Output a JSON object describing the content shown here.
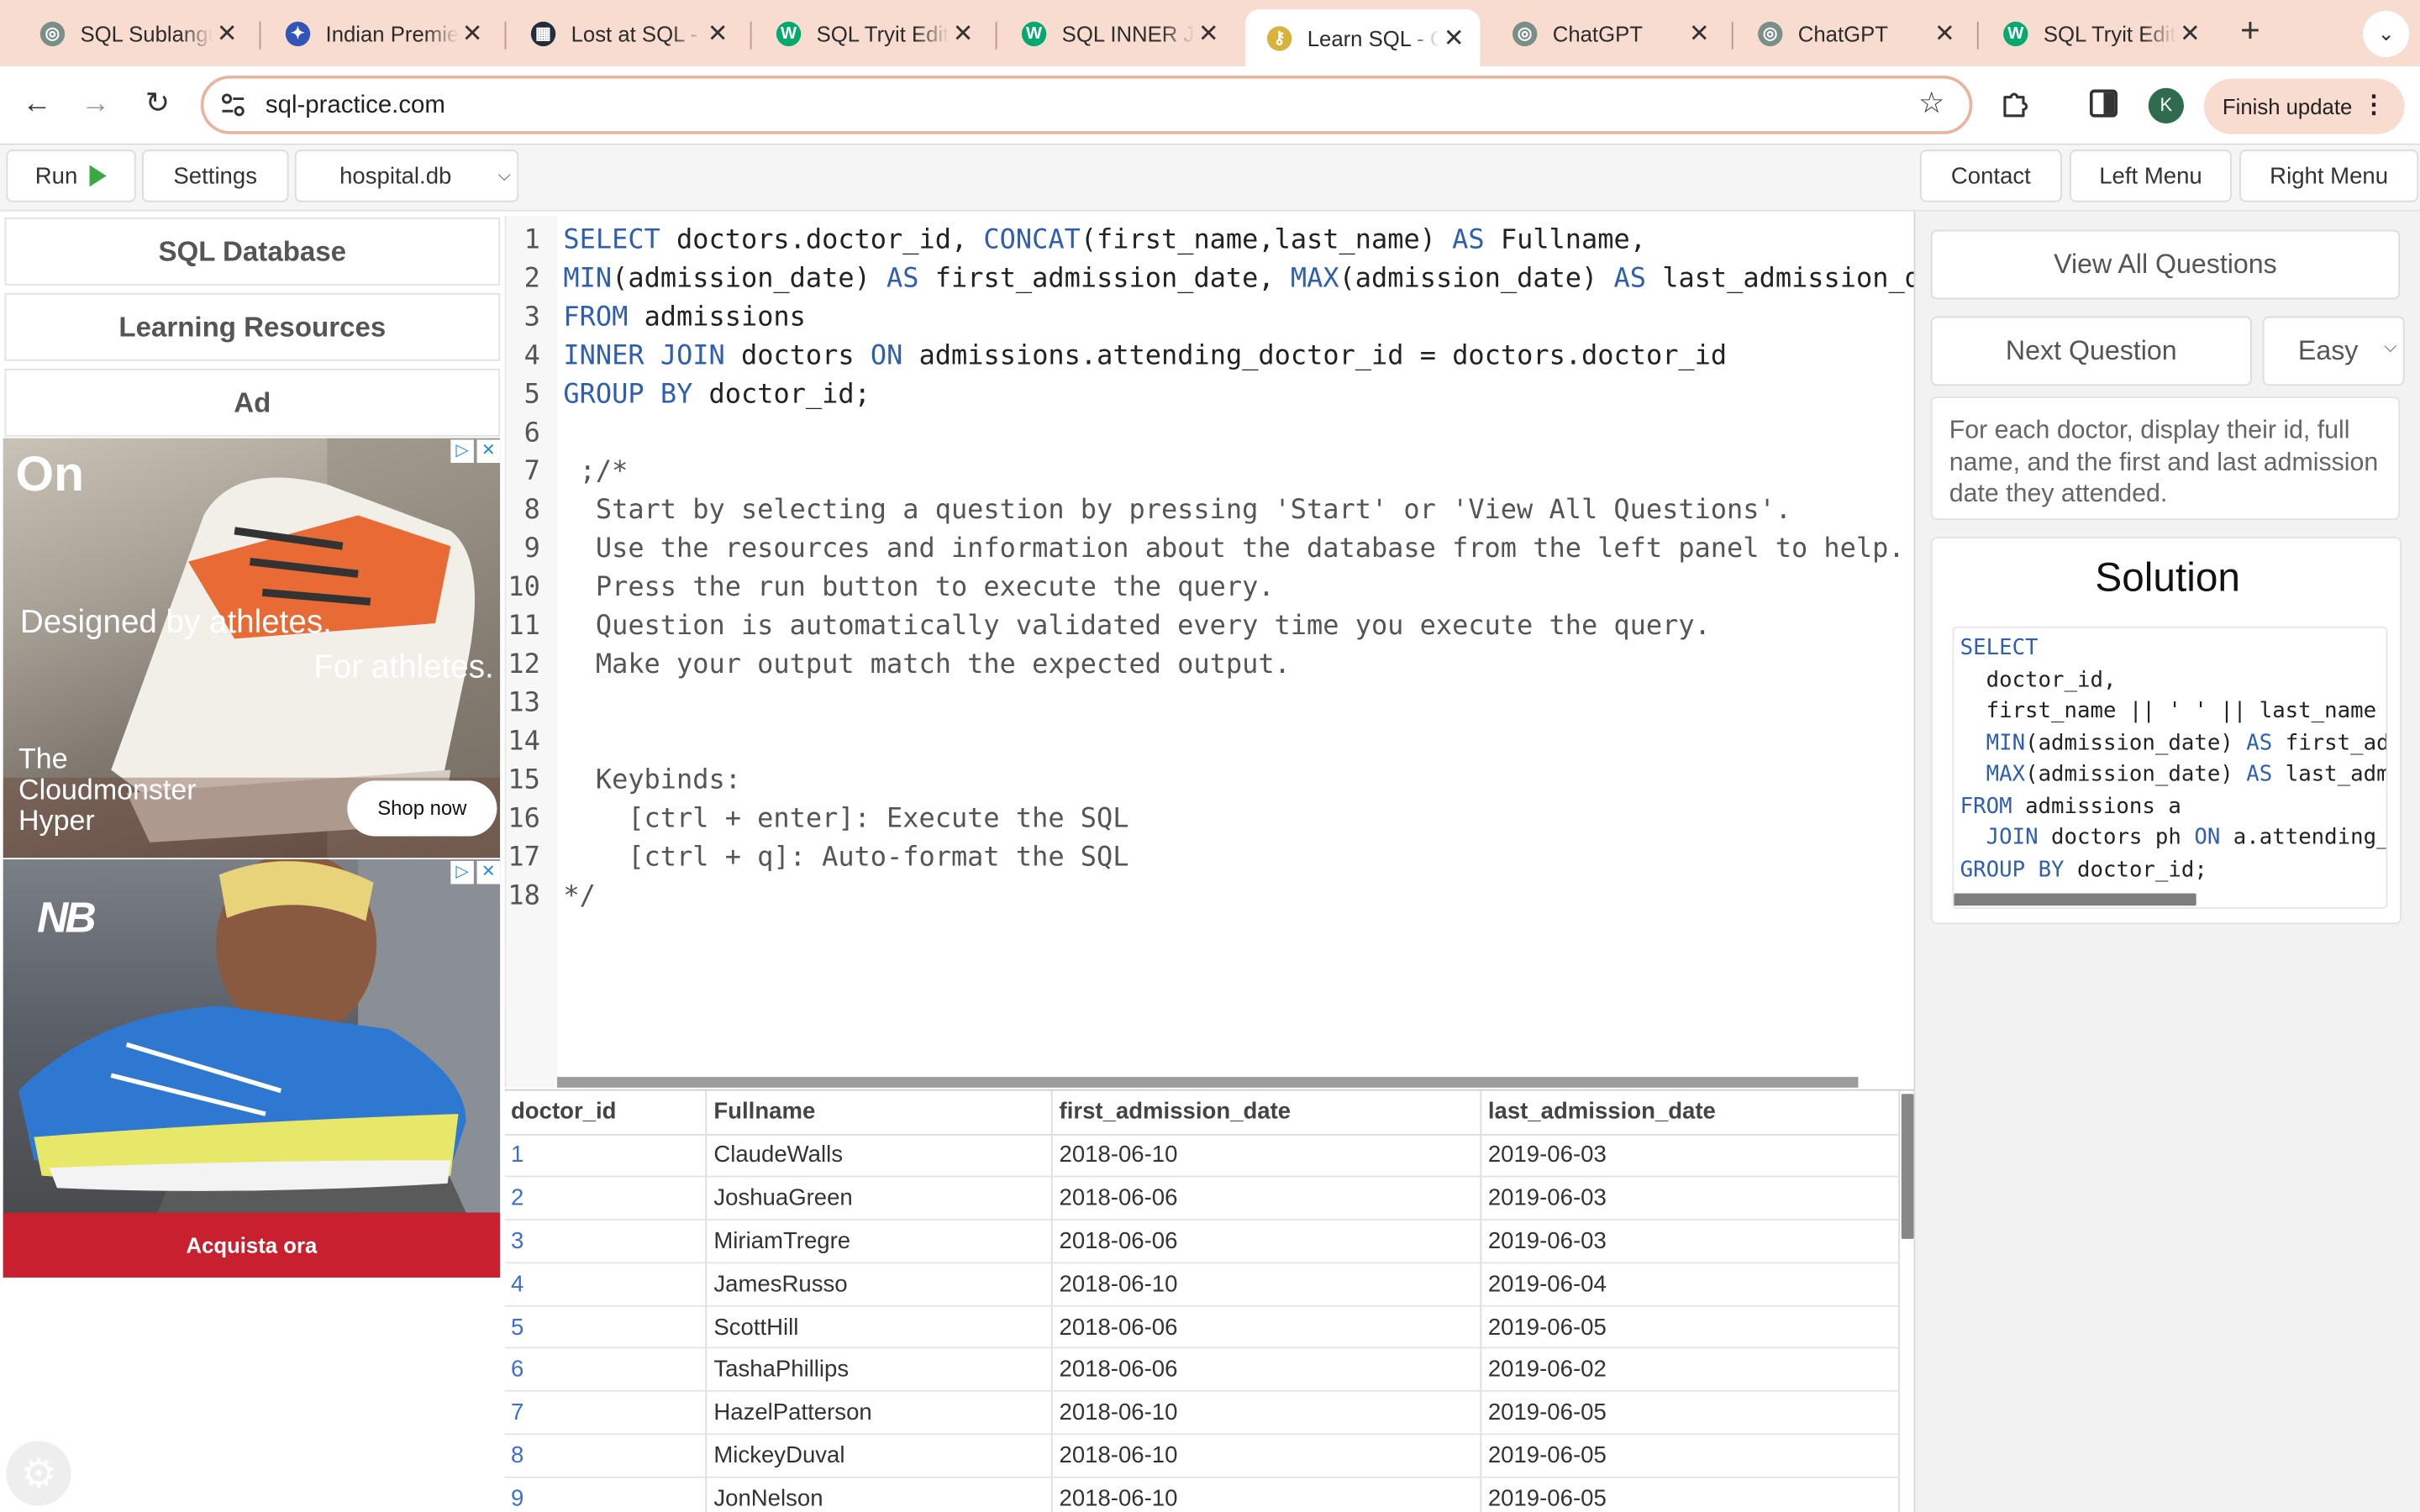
{
  "browser": {
    "tabs": [
      {
        "label": "SQL Sublanguage",
        "color": "#7a8f8a",
        "glyph": "◎"
      },
      {
        "label": "Indian Premier League",
        "color": "#3455b8",
        "glyph": "✦"
      },
      {
        "label": "Lost at SQL - Game",
        "color": "#222c3a",
        "glyph": "▦"
      },
      {
        "label": "SQL Tryit Editor",
        "color": "#04aa6d",
        "glyph": "W"
      },
      {
        "label": "SQL INNER JOIN",
        "color": "#04aa6d",
        "glyph": "W"
      },
      {
        "label": "Learn SQL - Online",
        "color": "#d8b23a",
        "glyph": "⚷"
      },
      {
        "label": "ChatGPT",
        "color": "#7a8f8a",
        "glyph": "◎"
      },
      {
        "label": "ChatGPT",
        "color": "#7a8f8a",
        "glyph": "◎"
      },
      {
        "label": "SQL Tryit Editor",
        "color": "#04aa6d",
        "glyph": "W"
      }
    ],
    "new_tab_symbol": "+",
    "tab_close_symbol": "✕",
    "url": "sql-practice.com",
    "profile_initial": "K",
    "finish_update_label": "Finish update",
    "menu_dots": "⋮"
  },
  "app": {
    "run_label": "Run",
    "settings_label": "Settings",
    "database_select": "hospital.db",
    "contact_label": "Contact",
    "left_menu_label": "Left Menu",
    "right_menu_label": "Right Menu"
  },
  "sidebar": {
    "sql_database_label": "SQL Database",
    "learning_resources_label": "Learning Resources",
    "ad_label": "Ad",
    "ad1_logo": "On",
    "ad1_headline_1": "Designed by athletes.",
    "ad1_headline_2": "For athletes.",
    "ad1_product": "The Cloudmonster Hyper",
    "ad1_cta": "Shop now",
    "ad2_logo": "NB",
    "ad2_cta": "Acquista ora"
  },
  "editor": {
    "lines": [
      "SELECT doctors.doctor_id, CONCAT(first_name,last_name) AS Fullname,",
      "MIN(admission_date) AS first_admission_date, MAX(admission_date) AS last_admission_date",
      "FROM admissions",
      "INNER JOIN doctors ON admissions.attending_doctor_id = doctors.doctor_id",
      "GROUP BY doctor_id;",
      "",
      " ;/*",
      "  Start by selecting a question by pressing 'Start' or 'View All Questions'.",
      "  Use the resources and information about the database from the left panel to help.",
      "  Press the run button to execute the query.",
      "  Question is automatically validated every time you execute the query.",
      "  Make your output match the expected output.",
      "",
      "",
      "  Keybinds:",
      "    [ctrl + enter]: Execute the SQL",
      "    [ctrl + q]: Auto-format the SQL",
      "*/"
    ]
  },
  "results": {
    "columns": [
      "doctor_id",
      "Fullname",
      "first_admission_date",
      "last_admission_date"
    ],
    "rows": [
      [
        "1",
        "ClaudeWalls",
        "2018-06-10",
        "2019-06-03"
      ],
      [
        "2",
        "JoshuaGreen",
        "2018-06-06",
        "2019-06-03"
      ],
      [
        "3",
        "MiriamTregre",
        "2018-06-06",
        "2019-06-03"
      ],
      [
        "4",
        "JamesRusso",
        "2018-06-10",
        "2019-06-04"
      ],
      [
        "5",
        "ScottHill",
        "2018-06-06",
        "2019-06-05"
      ],
      [
        "6",
        "TashaPhillips",
        "2018-06-06",
        "2019-06-02"
      ],
      [
        "7",
        "HazelPatterson",
        "2018-06-10",
        "2019-06-05"
      ],
      [
        "8",
        "MickeyDuval",
        "2018-06-10",
        "2019-06-05"
      ],
      [
        "9",
        "JonNelson",
        "2018-06-10",
        "2019-06-05"
      ]
    ]
  },
  "right_panel": {
    "view_all_label": "View All Questions",
    "next_question_label": "Next Question",
    "difficulty": "Easy",
    "question_text": "For each doctor, display their id, full name, and the first and last admission date they attended.",
    "solution_title": "Solution",
    "solution_lines": [
      "SELECT",
      "  doctor_id,",
      "  first_name || ' ' || last_name AS full_name,",
      "  MIN(admission_date) AS first_admission_date,",
      "  MAX(admission_date) AS last_admission_date",
      "FROM admissions a",
      "  JOIN doctors ph ON a.attending_doctor_id = ph.doctor_id",
      "GROUP BY doctor_id;"
    ]
  },
  "colors": {
    "accent_keyword": "#2f5fb0",
    "run_green": "#3aa845",
    "tabstrip": "#f8dccf",
    "ad_red": "#c8202f"
  }
}
